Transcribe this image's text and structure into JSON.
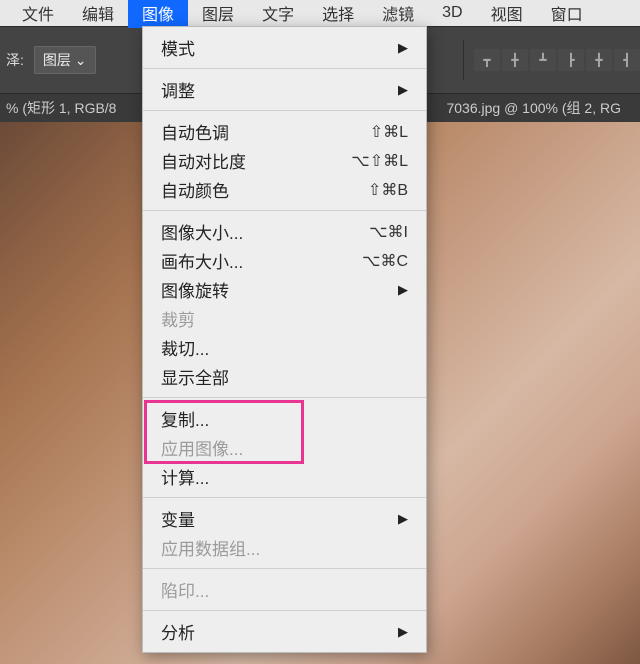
{
  "menubar": {
    "items": [
      "文件",
      "编辑",
      "图像",
      "图层",
      "文字",
      "选择",
      "滤镜",
      "3D",
      "视图",
      "窗口"
    ],
    "activeIndex": 2
  },
  "toolbar": {
    "label_left": "泽:",
    "dropdown_value": "图层",
    "dropdown_caret": "⌄"
  },
  "tabbar": {
    "tab1": "% (矩形 1, RGB/8",
    "tab2": "7036.jpg @ 100% (组 2, RG"
  },
  "menu": {
    "mode": {
      "label": "模式",
      "submenu": "▶"
    },
    "adjust": {
      "label": "调整",
      "submenu": "▶"
    },
    "auto_tone": {
      "label": "自动色调",
      "shortcut": "⇧⌘L"
    },
    "auto_contrast": {
      "label": "自动对比度",
      "shortcut": "⌥⇧⌘L"
    },
    "auto_color": {
      "label": "自动颜色",
      "shortcut": "⇧⌘B"
    },
    "image_size": {
      "label": "图像大小...",
      "shortcut": "⌥⌘I"
    },
    "canvas_size": {
      "label": "画布大小...",
      "shortcut": "⌥⌘C"
    },
    "image_rotate": {
      "label": "图像旋转",
      "submenu": "▶"
    },
    "crop": {
      "label": "裁剪"
    },
    "trim": {
      "label": "裁切..."
    },
    "reveal_all": {
      "label": "显示全部"
    },
    "duplicate": {
      "label": "复制..."
    },
    "apply_image": {
      "label": "应用图像..."
    },
    "calculations": {
      "label": "计算..."
    },
    "variables": {
      "label": "变量",
      "submenu": "▶"
    },
    "apply_dataset": {
      "label": "应用数据组..."
    },
    "trap": {
      "label": "陷印..."
    },
    "analysis": {
      "label": "分析",
      "submenu": "▶"
    }
  }
}
